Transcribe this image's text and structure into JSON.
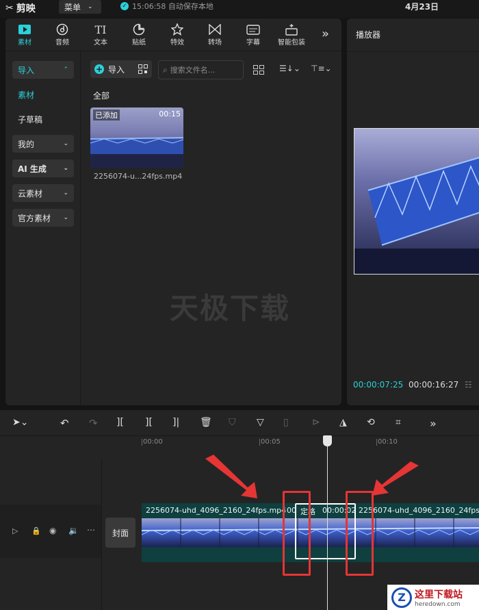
{
  "app": {
    "logo": "剪映",
    "menu_label": "菜单",
    "autosave": "15:06:58 自动保存本地",
    "date": "4月23日"
  },
  "tools": [
    {
      "label": "素材",
      "icon": "media-play-icon"
    },
    {
      "label": "音频",
      "icon": "audio-icon"
    },
    {
      "label": "文本",
      "icon": "text-icon"
    },
    {
      "label": "贴纸",
      "icon": "sticker-icon"
    },
    {
      "label": "特效",
      "icon": "effects-star-icon"
    },
    {
      "label": "转场",
      "icon": "transition-icon"
    },
    {
      "label": "字幕",
      "icon": "subtitle-icon"
    },
    {
      "label": "智能包装",
      "icon": "smart-package-icon"
    }
  ],
  "sidebar": {
    "import": "导入",
    "material": "素材",
    "sub_draft": "子草稿",
    "mine": "我的",
    "ai": "AI 生成",
    "cloud": "云素材",
    "official": "官方素材"
  },
  "media": {
    "import_btn": "导入",
    "search_placeholder": "搜索文件名...",
    "all_label": "全部",
    "thumb_added": "已添加",
    "thumb_duration": "00:15",
    "file_name": "2256074-u...24fps.mp4",
    "watermark": "天极下载"
  },
  "player": {
    "title": "播放器",
    "current_time": "00:00:07:25",
    "total_time": "00:00:16:27"
  },
  "timeline": {
    "ruler": [
      "00:00",
      "00:05",
      "00:10"
    ],
    "clip_left_label": "2256074-uhd_4096_2160_24fps.mp4",
    "clip_left_extra": "00",
    "clip_mid_label": "定格",
    "clip_mid_time": "00:00:02",
    "clip_right_label": "2256074-uhd_4096_2160_24fps.",
    "cover": "封面"
  },
  "badge": {
    "title": "这里下载站",
    "url": "heredown.com"
  },
  "colors": {
    "accent": "#2bd1d9",
    "annotation": "#e53535"
  }
}
